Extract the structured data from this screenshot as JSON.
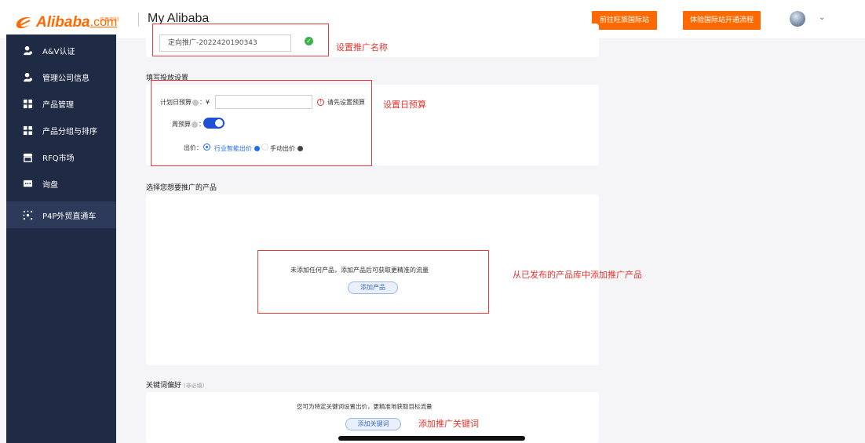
{
  "header": {
    "logo_text": "Alibaba",
    "logo_com": ".com",
    "logo_sub": "仿真实训",
    "brand": "My Alibaba",
    "btn_international": "前往旺旅国际站",
    "btn_open_flow": "体验国际站开通流程",
    "brand_color": "#ff6a00"
  },
  "sidebar": {
    "items": [
      {
        "label": "A&V认证",
        "icon": "user-icon"
      },
      {
        "label": "管理公司信息",
        "icon": "user-icon"
      },
      {
        "label": "产品管理",
        "icon": "grid-icon"
      },
      {
        "label": "产品分组与排序",
        "icon": "grid-icon"
      },
      {
        "label": "RFQ市场",
        "icon": "store-icon"
      },
      {
        "label": "询盘",
        "icon": "chat-icon"
      },
      {
        "label": "P4P外贸直通车",
        "icon": "network-icon",
        "active": true
      }
    ]
  },
  "promo_name": {
    "value": "定向推广-2022420190343",
    "annotation": "设置推广名称"
  },
  "delivery": {
    "title": "填写投放设置",
    "daily_budget_label": "计划日预算",
    "currency": "：¥",
    "budget_warning": "请先设置预算",
    "weekly_budget_label": "周预算",
    "bid_label": "出价：",
    "bid_option_smart": "行业智能出价",
    "bid_option_manual": "手动出价",
    "annotation": "设置日预算"
  },
  "products": {
    "title": "选择您想要推广的产品",
    "empty_text": "未添加任何产品，添加产品后可获取更精准的流量",
    "add_button": "添加产品",
    "annotation": "从已发布的产品库中添加推广产品"
  },
  "keywords": {
    "title": "关键词偏好",
    "optional": "(非必填)",
    "hint": "您可为特定关键词设置出价，更精准地获取目标流量",
    "add_button": "添加关键词",
    "annotation": "添加推广关键词"
  }
}
